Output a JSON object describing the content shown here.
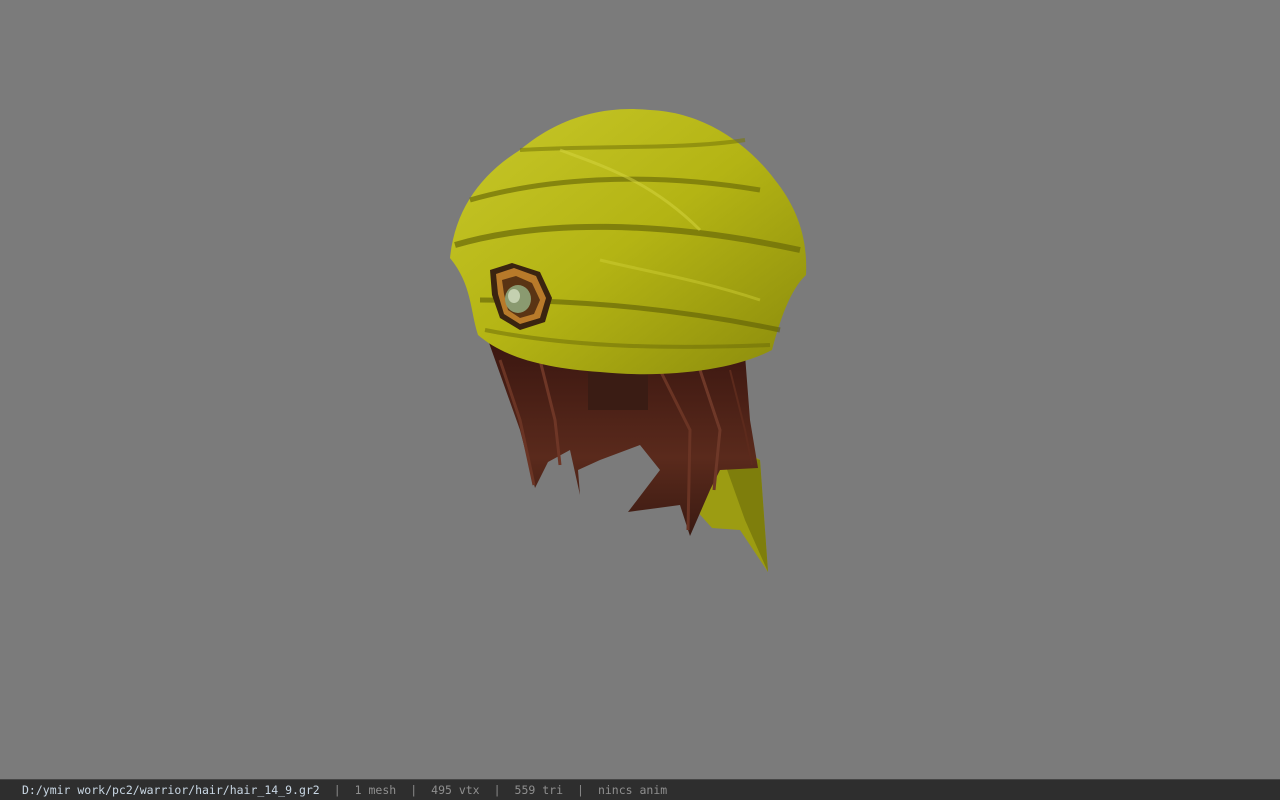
{
  "status_bar": {
    "file_path": "D:/ymir work/pc2/warrior/hair/hair_14_9.gr2",
    "separator": "|",
    "mesh_count": "1 mesh",
    "vertex_count": "495 vtx",
    "triangle_count": "559 tri",
    "animation_info": "nincs anim"
  },
  "colors": {
    "background": "#7b7b7b",
    "statusbar_bg": "#2e2e2e",
    "path_text": "#c9d7e4",
    "stat_text": "#8f8f8f",
    "turban": "#b8b818",
    "hair": "#4a1e14"
  }
}
